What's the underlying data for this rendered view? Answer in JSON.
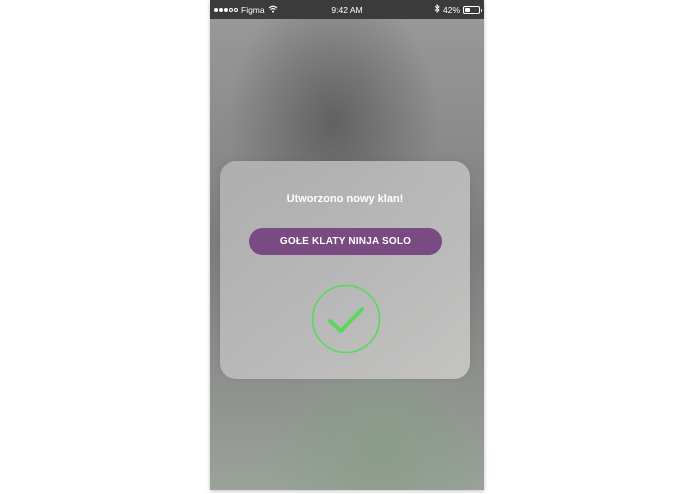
{
  "status_bar": {
    "signal_full": 3,
    "signal_empty": 2,
    "carrier": "Figma",
    "time": "9:42 AM",
    "battery": "42%",
    "battery_level": 0.42,
    "icons": [
      "wifi-icon",
      "bluetooth-icon",
      "battery-icon"
    ]
  },
  "dialog": {
    "title": "Utworzono nowy klan!",
    "clan_name": "GOŁE KLATY NINJA SOLO",
    "success_icon": "checkmark-icon"
  },
  "colors": {
    "status_bar_bg": "#3b3b3b",
    "pill_bg": "#7a4a82",
    "check_green": "#5bd85b"
  }
}
